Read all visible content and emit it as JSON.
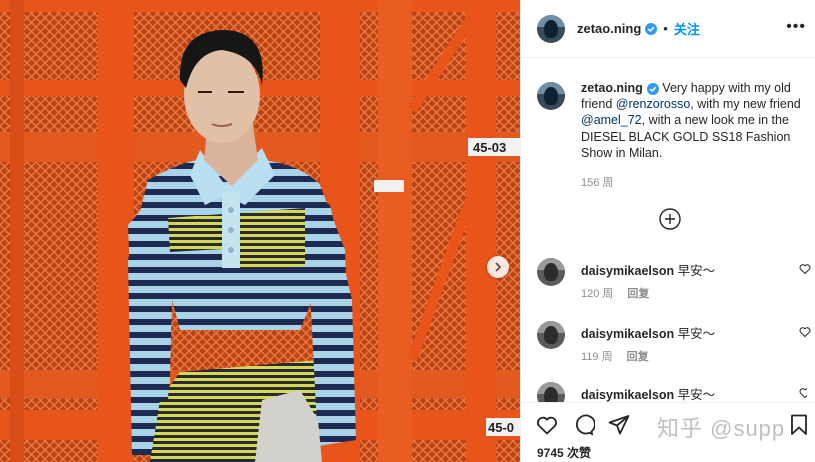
{
  "post": {
    "author": "zetao.ning",
    "dot": "•",
    "follow_label": "关注",
    "more_label": "•••",
    "caption_pre": "Very happy with my old friend ",
    "mention_1": "@renzorosso",
    "caption_mid": ", with my new friend ",
    "mention_2": "@amel_72",
    "caption_post": ", with a new look me in the DIESEL BLACK GOLD SS18 Fashion Show in Milan.",
    "caption_time": "156 周",
    "photo_signs": [
      "45-03",
      "45-0"
    ],
    "likes": "9745 次赞"
  },
  "comments": [
    {
      "user": "daisymikaelson",
      "text": "早安～",
      "time": "120 周",
      "reply": "回复"
    },
    {
      "user": "daisymikaelson",
      "text": "早安～",
      "time": "119 周",
      "reply": "回复"
    },
    {
      "user": "daisymikaelson",
      "text": "早安～",
      "time": "",
      "reply": ""
    }
  ],
  "watermark": "知乎 @supp",
  "colors": {
    "accent": "#0095f6",
    "verified": "#3897f0",
    "mention": "#00376b",
    "muted": "#8e8e8e",
    "rack": "#e8541a"
  },
  "icons": [
    "heart-icon",
    "comment-icon",
    "share-icon",
    "bookmark-icon",
    "plus-circle-icon",
    "chevron-right-icon",
    "verified-badge-icon",
    "more-icon"
  ]
}
